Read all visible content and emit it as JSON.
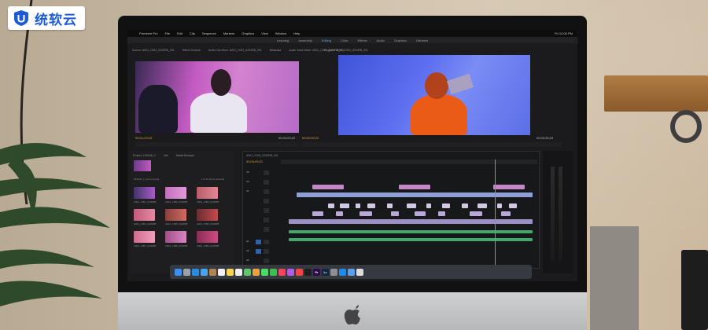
{
  "watermark": {
    "text": "统软云"
  },
  "menubar": {
    "items": [
      "Premiere Pro",
      "File",
      "Edit",
      "Clip",
      "Sequence",
      "Markers",
      "Graphics",
      "View",
      "Window",
      "Help"
    ],
    "clock": "Fri 12:00 PM"
  },
  "workspaces": {
    "items": [
      "Learning",
      "Assembly",
      "Editing",
      "Color",
      "Effects",
      "Audio",
      "Graphics",
      "Libraries"
    ],
    "active_index": 2
  },
  "source_monitor": {
    "tabs": [
      "Source: A001_C002_0220RB_001",
      "Effect Controls",
      "Audio Clip Mixer: A001_C002_0220RB_001",
      "Metadata",
      "Audio Track Mixer: A001_C002_0220RB_001"
    ],
    "timecode_in": "00;01;29;03",
    "timecode_dur": "00;00;03;22"
  },
  "program_monitor": {
    "tab": "Program: A001_C002_0220RB_001",
    "timecode_in": "00;00;09;21",
    "timecode_dur": "00;00;28;18"
  },
  "project_panel": {
    "tabs": [
      "Project: 190108_V",
      "Info",
      "Media Browser"
    ],
    "file": "190108_V_tyrone.prproj",
    "count": "1 of 15 items selected",
    "clips": [
      {
        "label": "A001_C001_0220RB"
      },
      {
        "label": "A001_C002_0220RB"
      },
      {
        "label": "A001_C003_0220RB"
      },
      {
        "label": "A001_C004_0220RB"
      },
      {
        "label": "A001_C005_0220RB"
      },
      {
        "label": "A001_C006_0220RB"
      },
      {
        "label": "A001_C007_0220RB"
      },
      {
        "label": "A001_C008_0220RB"
      },
      {
        "label": "A001_C009_0220RB"
      }
    ]
  },
  "timeline": {
    "tab": "A001_C002_0220RB_001",
    "timecode": "00;00;09;21",
    "tracks": [
      "V3",
      "V2",
      "V1",
      "A1",
      "A2",
      "A3"
    ]
  },
  "dock": {
    "icons": [
      {
        "name": "finder",
        "color": "#3b8ff0",
        "glyph": ""
      },
      {
        "name": "launchpad",
        "color": "#9aa1ad",
        "glyph": ""
      },
      {
        "name": "safari",
        "color": "#2a8be0",
        "glyph": ""
      },
      {
        "name": "mail",
        "color": "#4aa3f2",
        "glyph": ""
      },
      {
        "name": "contacts",
        "color": "#b08454",
        "glyph": ""
      },
      {
        "name": "calendar",
        "color": "#f2f2f2",
        "glyph": ""
      },
      {
        "name": "notes",
        "color": "#f5d453",
        "glyph": ""
      },
      {
        "name": "reminders",
        "color": "#eeeeee",
        "glyph": ""
      },
      {
        "name": "maps",
        "color": "#64c46c",
        "glyph": ""
      },
      {
        "name": "photos",
        "color": "#f0a03a",
        "glyph": ""
      },
      {
        "name": "messages",
        "color": "#4cd964",
        "glyph": ""
      },
      {
        "name": "facetime",
        "color": "#39c24a",
        "glyph": ""
      },
      {
        "name": "music",
        "color": "#f3445c",
        "glyph": ""
      },
      {
        "name": "podcasts",
        "color": "#b05af0",
        "glyph": ""
      },
      {
        "name": "news",
        "color": "#ef4646",
        "glyph": ""
      },
      {
        "name": "stocks",
        "color": "#1e1e1e",
        "glyph": ""
      },
      {
        "name": "premiere-pro",
        "color": "#2a0a4a",
        "glyph": "Pr"
      },
      {
        "name": "lightroom",
        "color": "#0d2740",
        "glyph": "Lr"
      },
      {
        "name": "system-preferences",
        "color": "#8e8e93",
        "glyph": ""
      },
      {
        "name": "app-store",
        "color": "#1a8cf0",
        "glyph": ""
      },
      {
        "name": "finder-2",
        "color": "#5aa0e8",
        "glyph": ""
      },
      {
        "name": "trash",
        "color": "#dcdcdc",
        "glyph": ""
      }
    ]
  }
}
